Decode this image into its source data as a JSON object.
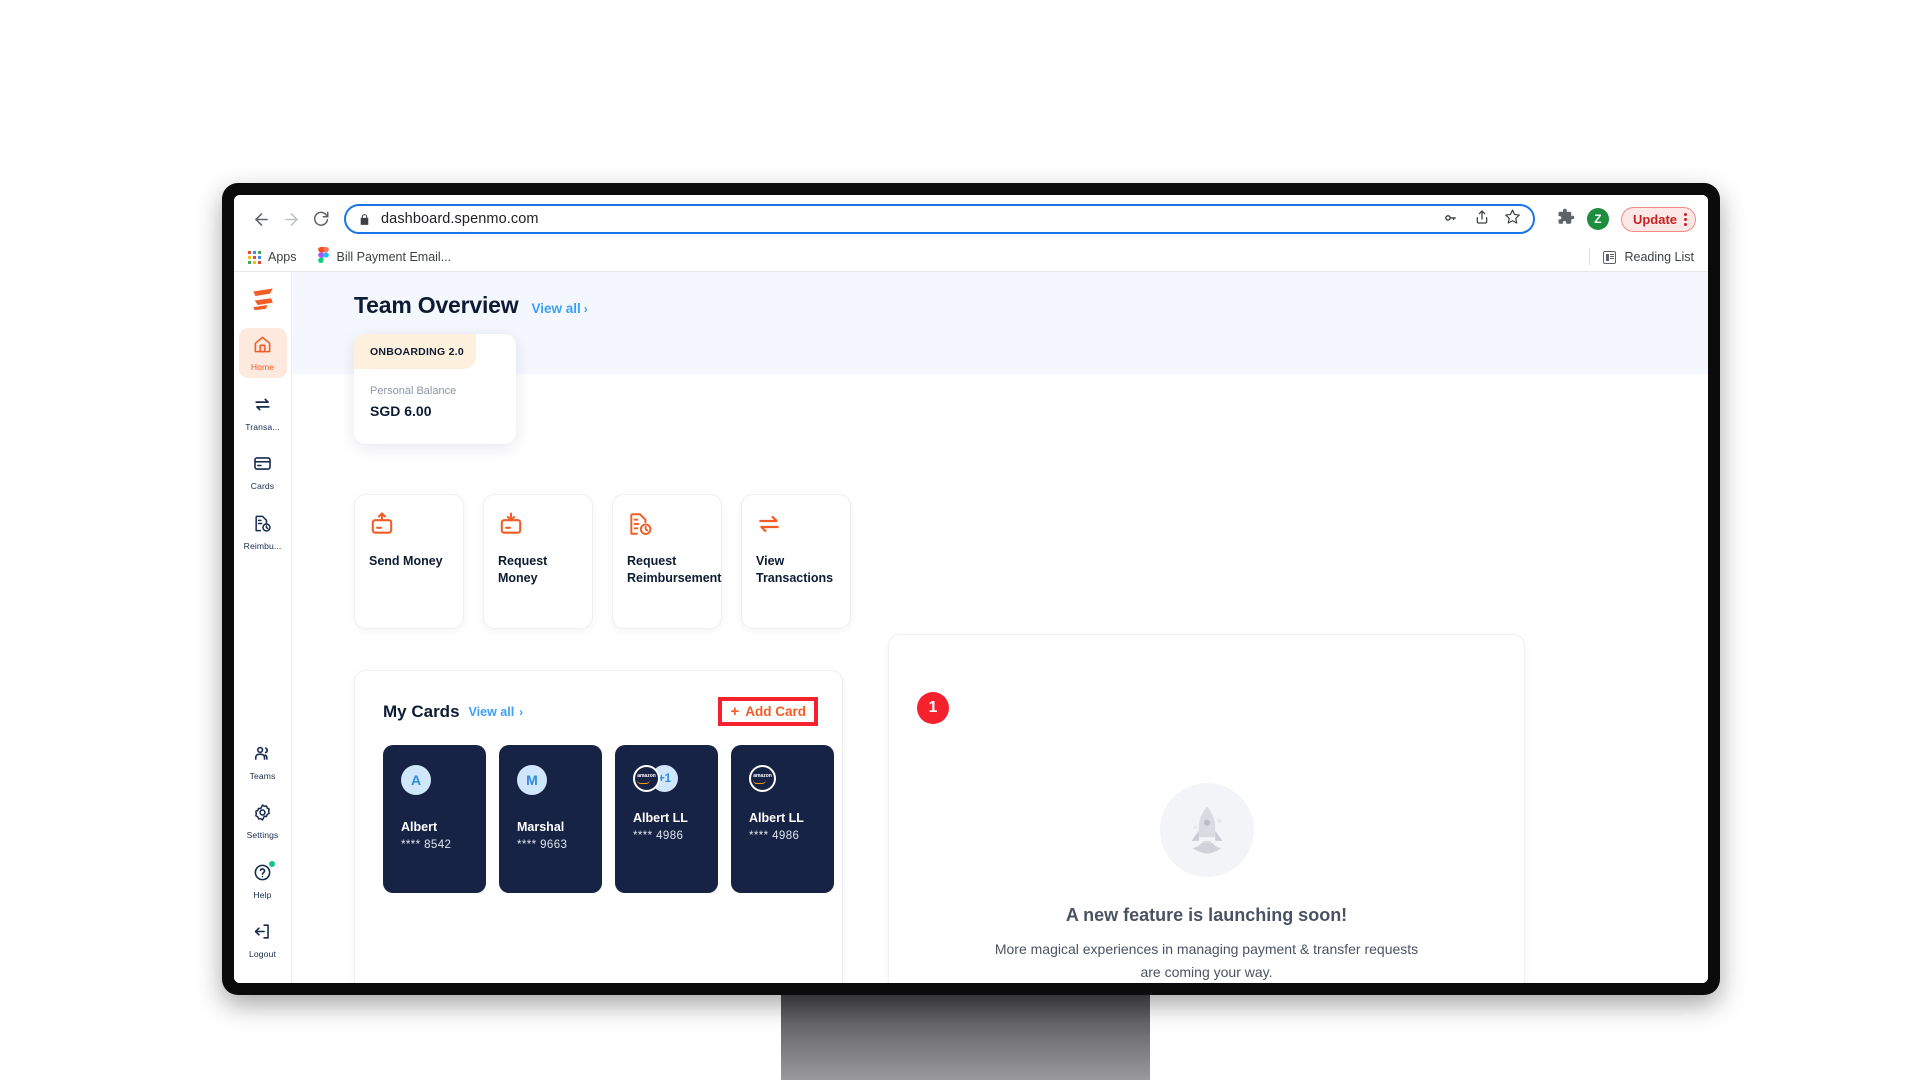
{
  "browser": {
    "url": "dashboard.spenmo.com",
    "back_icon": "back-arrow-icon",
    "forward_icon": "forward-arrow-icon",
    "reload_icon": "reload-icon",
    "lock_icon": "lock-icon",
    "password_icon": "key-icon",
    "share_icon": "share-icon",
    "bookmark_icon": "star-icon",
    "extensions_icon": "puzzle-icon",
    "profile_initial": "Z",
    "update_label": "Update",
    "menu_icon": "kebab-menu-icon",
    "bookmarks": [
      {
        "label": "Apps",
        "icon": "apps-grid-icon"
      },
      {
        "label": "Bill Payment Email...",
        "icon": "figma-icon"
      }
    ],
    "reading_list_label": "Reading List",
    "reading_list_icon": "reading-list-icon"
  },
  "sidebar": {
    "logo_icon": "spenmo-logo-icon",
    "items": [
      {
        "label": "Home",
        "icon": "home-icon",
        "active": true
      },
      {
        "label": "Transa...",
        "icon": "transfer-icon",
        "active": false
      },
      {
        "label": "Cards",
        "icon": "credit-card-icon",
        "active": false
      },
      {
        "label": "Reimbu...",
        "icon": "receipt-clock-icon",
        "active": false
      }
    ],
    "bottom_items": [
      {
        "label": "Teams",
        "icon": "people-icon",
        "badge": false
      },
      {
        "label": "Settings",
        "icon": "gear-icon",
        "badge": false
      },
      {
        "label": "Help",
        "icon": "question-circle-icon",
        "badge": true
      },
      {
        "label": "Logout",
        "icon": "logout-icon",
        "badge": false
      }
    ]
  },
  "hero": {
    "title": "Team Overview",
    "view_all": "View all",
    "chevron": "›"
  },
  "balance_card": {
    "tab_label": "ONBOARDING 2.0",
    "label": "Personal Balance",
    "value": "SGD 6.00"
  },
  "tiles": [
    {
      "label": "Send Money",
      "icon": "send-money-icon"
    },
    {
      "label": "Request Money",
      "icon": "request-money-icon"
    },
    {
      "label": "Request Reimbursement",
      "icon": "request-reimbursement-icon"
    },
    {
      "label": "View Transactions",
      "icon": "view-transactions-icon"
    }
  ],
  "my_cards": {
    "title": "My Cards",
    "view_all": "View all",
    "chevron": "›",
    "add_card_label": "Add Card",
    "add_card_plus": "+",
    "step_badge": "1",
    "cards": [
      {
        "type": "avatar",
        "initial": "A",
        "name": "Albert",
        "number": "**** 8542"
      },
      {
        "type": "avatar",
        "initial": "M",
        "name": "Marshal",
        "number": "**** 9663"
      },
      {
        "type": "merchant",
        "merchant": "amazon",
        "extra": "+1",
        "name": "Albert LL",
        "number": "**** 4986"
      },
      {
        "type": "merchant",
        "merchant": "amazon",
        "extra": "",
        "name": "Albert LL",
        "number": "**** 4986"
      }
    ]
  },
  "right_panel": {
    "illustration": "rocket-icon",
    "title": "A new feature is launching soon!",
    "subtitle": "More magical experiences in managing payment & transfer requests are coming your way."
  },
  "colors": {
    "brand_orange": "#f25c26",
    "link_blue": "#3ba0f7",
    "annotation_red": "#f5222d",
    "card_navy": "#172344"
  }
}
